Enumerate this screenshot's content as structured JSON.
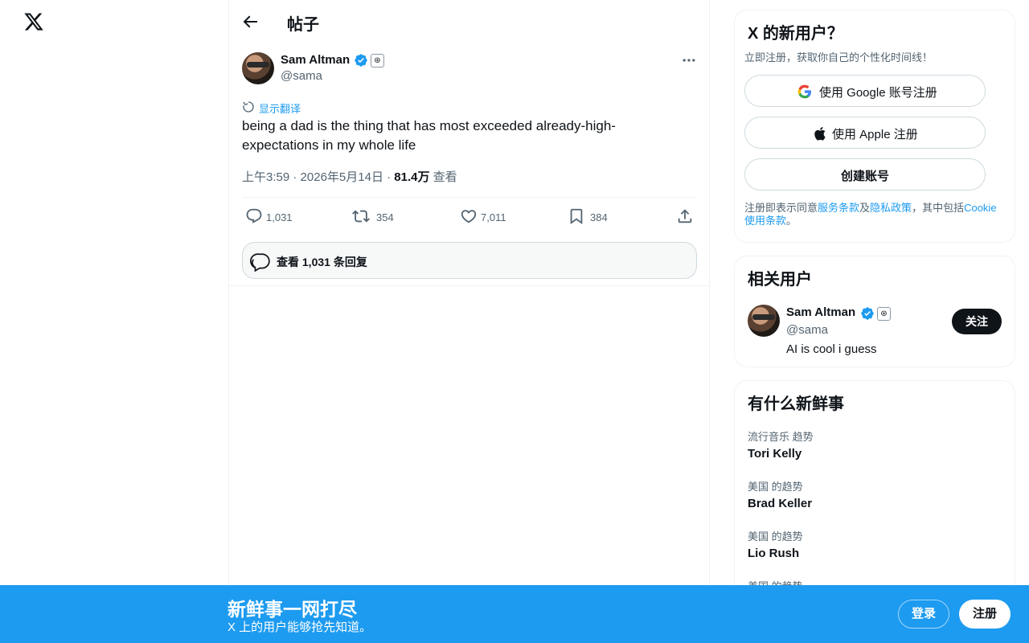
{
  "header": {
    "title": "帖子"
  },
  "tweet": {
    "author_name": "Sam Altman",
    "author_handle": "@sama",
    "affiliate_badge": "⊛",
    "translate_label": "显示翻译",
    "text": "being a dad is the thing that has most exceeded already-high-expectations in my whole life",
    "time": "上午3:59",
    "date": "2026年5月14日",
    "views": "81.4万",
    "views_label": "查看",
    "separator": "·",
    "replies": "1,031",
    "retweets": "354",
    "likes": "7,011",
    "bookmarks": "384",
    "view_replies_label": "查看 1,031 条回复"
  },
  "signup_card": {
    "title": "X 的新用户？",
    "subtitle": "立即注册，获取你自己的个性化时间线！",
    "google_label": "使用 Google 账号注册",
    "apple_label": "使用 Apple 注册",
    "create_label": "创建账号",
    "legal_prefix": "注册即表示同意",
    "terms_link": "服务条款",
    "and_text": "及",
    "privacy_link": "隐私政策",
    "including_text": "，其中包括",
    "cookie_link": "Cookie 使用条款",
    "period": "。"
  },
  "related": {
    "title": "相关用户",
    "name": "Sam Altman",
    "handle": "@sama",
    "bio": "AI is cool i guess",
    "follow_label": "关注"
  },
  "trends": {
    "title": "有什么新鲜事",
    "items": [
      {
        "category": "流行音乐 趋势",
        "name": "Tori Kelly"
      },
      {
        "category": "美国 的趋势",
        "name": "Brad Keller"
      },
      {
        "category": "美国 的趋势",
        "name": "Lio Rush"
      },
      {
        "category": "美国 的趋势",
        "name": ""
      }
    ]
  },
  "banner": {
    "title": "新鲜事一网打尽",
    "subtitle": "X 上的用户能够抢先知道。",
    "login_label": "登录",
    "signup_label": "注册"
  },
  "colors": {
    "accent": "#1d9bf0",
    "text": "#0f1419",
    "muted": "#536471",
    "border": "#eff3f4"
  },
  "icons": [
    "x-logo-icon",
    "back-arrow-icon",
    "verified-icon",
    "more-icon",
    "translate-icon",
    "reply-icon",
    "retweet-icon",
    "like-icon",
    "bookmark-icon",
    "share-icon",
    "google-icon",
    "apple-icon"
  ]
}
